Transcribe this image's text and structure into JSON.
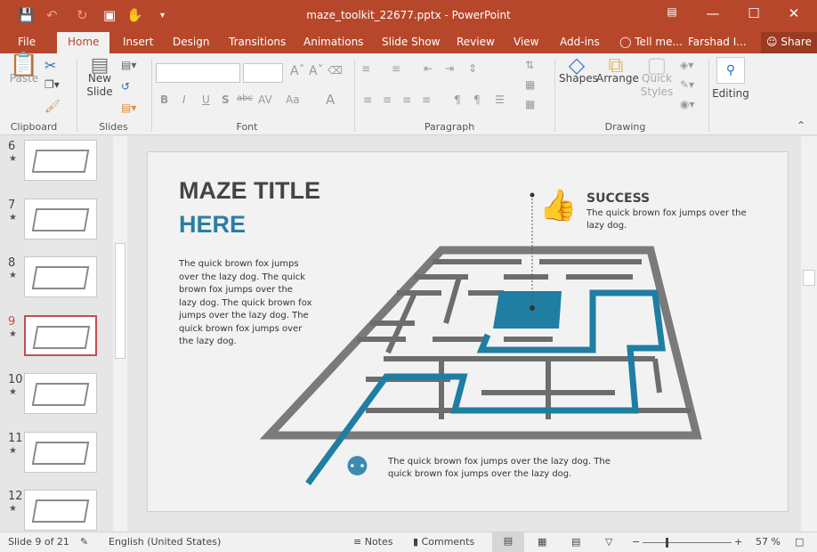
{
  "window": {
    "title": "maze_toolkit_22677.pptx - PowerPoint",
    "accent": "#b7472a"
  },
  "tabs": [
    "File",
    "Home",
    "Insert",
    "Design",
    "Transitions",
    "Animations",
    "Slide Show",
    "Review",
    "View",
    "Add-ins"
  ],
  "tell_me": "Tell me...",
  "user": "Farshad I...",
  "share": "Share",
  "ribbon": {
    "paste": "Paste",
    "new_slide_1": "New",
    "new_slide_2": "Slide",
    "shapes": "Shapes",
    "arrange": "Arrange",
    "quick_1": "Quick",
    "quick_2": "Styles",
    "editing": "Editing",
    "groups": [
      "Clipboard",
      "Slides",
      "Font",
      "Paragraph",
      "Drawing"
    ]
  },
  "thumbs": [
    {
      "num": "6"
    },
    {
      "num": "7"
    },
    {
      "num": "8"
    },
    {
      "num": "9",
      "selected": true
    },
    {
      "num": "10"
    },
    {
      "num": "11"
    },
    {
      "num": "12"
    }
  ],
  "slide": {
    "title1": "MAZE TITLE",
    "title2": "HERE",
    "title2_color": "#2a7ea6",
    "body": "The quick brown fox jumps over the lazy dog. The quick brown fox jumps over the lazy dog. The quick brown fox jumps over the lazy dog. The quick brown fox jumps over the lazy dog.",
    "success_title": "SUCCESS",
    "success_text": "The quick brown fox jumps over the lazy dog.",
    "bottom_text": "The quick brown fox jumps over the lazy dog. The quick brown fox jumps over the lazy dog.",
    "maze_blue": "#1f7ea1",
    "maze_grey": "#6d6d6d"
  },
  "status": {
    "slide": "Slide 9 of 21",
    "language": "English (United States)",
    "notes": "Notes",
    "comments": "Comments",
    "zoom": "57 %",
    "zoom_percent": 57
  }
}
